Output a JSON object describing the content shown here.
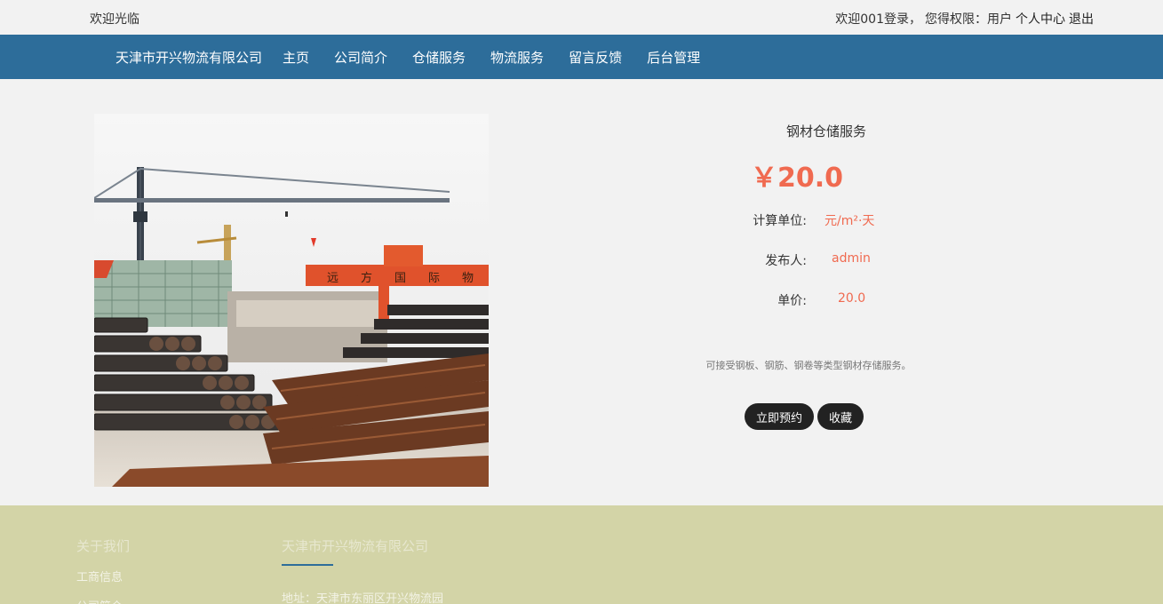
{
  "topbar": {
    "welcome": "欢迎光临",
    "user_greeting": "欢迎001登录，",
    "permission": "您得权限：用户",
    "user_center": "个人中心",
    "logout": "退出"
  },
  "navbar": {
    "brand": "天津市开兴物流有限公司",
    "items": [
      "主页",
      "公司简介",
      "仓储服务",
      "物流服务",
      "留言反馈",
      "后台管理"
    ]
  },
  "product": {
    "name": "钢材仓储服务",
    "price": "￥20.0",
    "unit_label": "计算单位:",
    "unit_value": "元/m²·天",
    "publisher_label": "发布人:",
    "publisher_value": "admin",
    "unit_price_label": "单价:",
    "unit_price_value": "20.0",
    "description": "可接受钢板、钢筋、钢卷等类型钢材存储服务。",
    "reserve_button": "立即预约",
    "favorite_button": "收藏"
  },
  "footer": {
    "about_heading": "关于我们",
    "links": [
      "工商信息",
      "公司简介"
    ],
    "company_heading": "天津市开兴物流有限公司",
    "address": "地址：天津市东丽区开兴物流园"
  },
  "colors": {
    "nav_bg": "#2d6d9a",
    "accent": "#f06a50",
    "footer_bg": "#d3d4a7"
  }
}
